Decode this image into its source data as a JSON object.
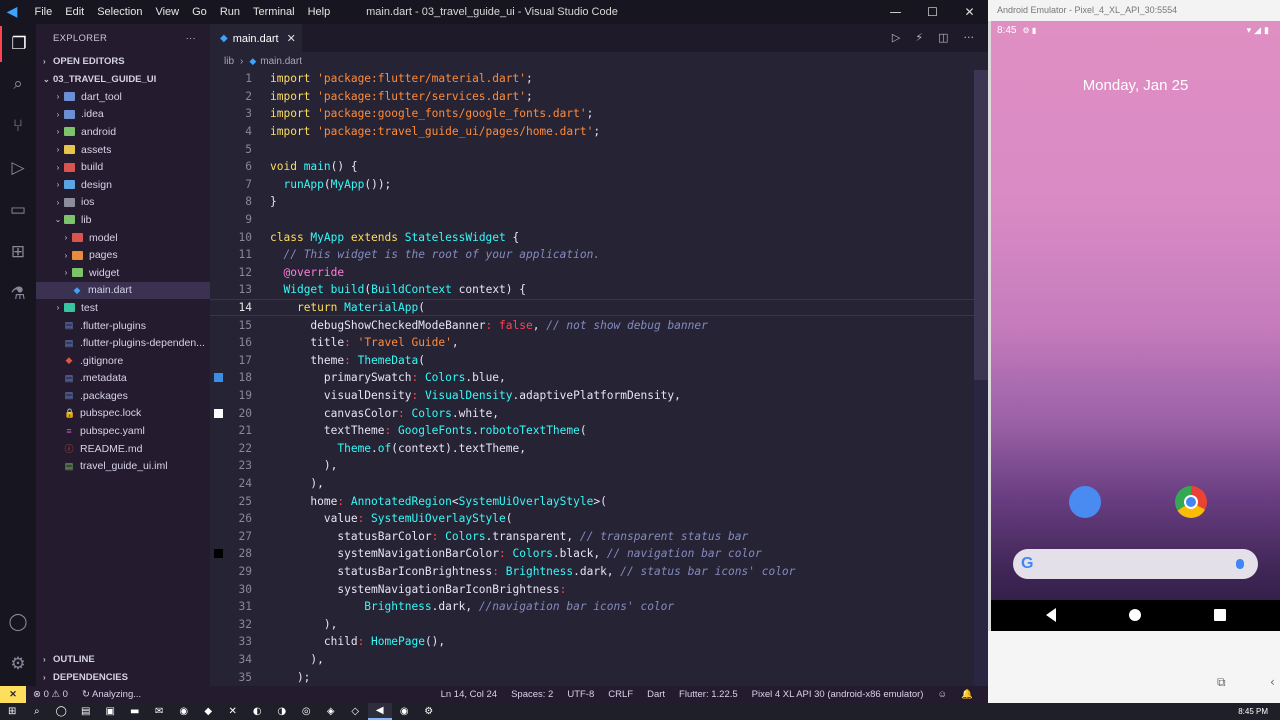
{
  "window": {
    "title": "main.dart - 03_travel_guide_ui - Visual Studio Code",
    "menu": [
      "File",
      "Edit",
      "Selection",
      "View",
      "Go",
      "Run",
      "Terminal",
      "Help"
    ]
  },
  "explorer": {
    "header": "EXPLORER",
    "more": "···",
    "open_editors": "OPEN EDITORS",
    "project": "03_TRAVEL_GUIDE_UI",
    "items": [
      {
        "label": "dart_tool",
        "color": "#6b8fd6",
        "kind": "folder",
        "depth": 1
      },
      {
        "label": ".idea",
        "color": "#6b8fd6",
        "kind": "folder",
        "depth": 1
      },
      {
        "label": "android",
        "color": "#7cc46b",
        "kind": "folder",
        "depth": 1
      },
      {
        "label": "assets",
        "color": "#e7c44a",
        "kind": "folder",
        "depth": 1
      },
      {
        "label": "build",
        "color": "#d9534f",
        "kind": "folder",
        "depth": 1
      },
      {
        "label": "design",
        "color": "#5aa5e6",
        "kind": "folder",
        "depth": 1
      },
      {
        "label": "ios",
        "color": "#8c8c9c",
        "kind": "folder",
        "depth": 1
      },
      {
        "label": "lib",
        "color": "#7cc46b",
        "kind": "folder-open",
        "depth": 1
      },
      {
        "label": "model",
        "color": "#d9534f",
        "kind": "folder",
        "depth": 2
      },
      {
        "label": "pages",
        "color": "#e98a3d",
        "kind": "folder",
        "depth": 2
      },
      {
        "label": "widget",
        "color": "#7cc46b",
        "kind": "folder",
        "depth": 2
      },
      {
        "label": "main.dart",
        "color": "#3ea3ff",
        "kind": "file-dart",
        "depth": 2
      },
      {
        "label": "test",
        "color": "#35c5a0",
        "kind": "folder",
        "depth": 1
      },
      {
        "label": ".flutter-plugins",
        "color": "#6b8fd6",
        "kind": "file",
        "depth": 1
      },
      {
        "label": ".flutter-plugins-dependen...",
        "color": "#6b8fd6",
        "kind": "file",
        "depth": 1
      },
      {
        "label": ".gitignore",
        "color": "#e0553d",
        "kind": "file-git",
        "depth": 1
      },
      {
        "label": ".metadata",
        "color": "#6b8fd6",
        "kind": "file",
        "depth": 1
      },
      {
        "label": ".packages",
        "color": "#6b8fd6",
        "kind": "file",
        "depth": 1
      },
      {
        "label": "pubspec.lock",
        "color": "#e7c44a",
        "kind": "file-lock",
        "depth": 1
      },
      {
        "label": "pubspec.yaml",
        "color": "#c75ab0",
        "kind": "file-yaml",
        "depth": 1
      },
      {
        "label": "README.md",
        "color": "#e0553d",
        "kind": "file-info",
        "depth": 1
      },
      {
        "label": "travel_guide_ui.iml",
        "color": "#7cc46b",
        "kind": "file",
        "depth": 1
      }
    ],
    "outline": "OUTLINE",
    "dependencies": "DEPENDENCIES"
  },
  "editor": {
    "tab": "main.dart",
    "breadcrumb": [
      "lib",
      "main.dart"
    ],
    "current_line": 14,
    "lines": [
      [
        [
          "k",
          "import "
        ],
        [
          "s",
          "'package:flutter/material.dart'"
        ],
        [
          "w",
          ";"
        ]
      ],
      [
        [
          "k",
          "import "
        ],
        [
          "s",
          "'package:flutter/services.dart'"
        ],
        [
          "w",
          ";"
        ]
      ],
      [
        [
          "k",
          "import "
        ],
        [
          "s",
          "'package:google_fonts/google_fonts.dart'"
        ],
        [
          "w",
          ";"
        ]
      ],
      [
        [
          "k",
          "import "
        ],
        [
          "s",
          "'package:travel_guide_ui/pages/home.dart'"
        ],
        [
          "w",
          ";"
        ]
      ],
      [],
      [
        [
          "k",
          "void "
        ],
        [
          "f",
          "main"
        ],
        [
          "w",
          "() {"
        ]
      ],
      [
        [
          "w",
          "  "
        ],
        [
          "f",
          "runApp"
        ],
        [
          "w",
          "("
        ],
        [
          "f",
          "MyApp"
        ],
        [
          "w",
          "());"
        ]
      ],
      [
        [
          "w",
          "}"
        ]
      ],
      [],
      [
        [
          "k",
          "class "
        ],
        [
          "f",
          "MyApp "
        ],
        [
          "k",
          "extends "
        ],
        [
          "f",
          "StatelessWidget "
        ],
        [
          "w",
          "{"
        ]
      ],
      [
        [
          "w",
          "  "
        ],
        [
          "c",
          "// This widget is the root of your application."
        ]
      ],
      [
        [
          "w",
          "  "
        ],
        [
          "p",
          "@override"
        ]
      ],
      [
        [
          "w",
          "  "
        ],
        [
          "f",
          "Widget "
        ],
        [
          "f",
          "build"
        ],
        [
          "w",
          "("
        ],
        [
          "f",
          "BuildContext "
        ],
        [
          "w",
          "context) {"
        ]
      ],
      [
        [
          "w",
          "    "
        ],
        [
          "k",
          "return "
        ],
        [
          "f",
          "MaterialApp"
        ],
        [
          "w",
          "("
        ]
      ],
      [
        [
          "w",
          "      debugShowCheckedModeBanner"
        ],
        [
          "t",
          ": "
        ],
        [
          "t",
          "false"
        ],
        [
          "w",
          ", "
        ],
        [
          "c",
          "// not show debug banner"
        ]
      ],
      [
        [
          "w",
          "      title"
        ],
        [
          "t",
          ": "
        ],
        [
          "s",
          "'Travel Guide'"
        ],
        [
          "w",
          ","
        ]
      ],
      [
        [
          "w",
          "      theme"
        ],
        [
          "t",
          ": "
        ],
        [
          "f",
          "ThemeData"
        ],
        [
          "w",
          "("
        ]
      ],
      [
        [
          "w",
          "        primarySwatch"
        ],
        [
          "t",
          ": "
        ],
        [
          "f",
          "Colors"
        ],
        [
          "w",
          ".blue,"
        ]
      ],
      [
        [
          "w",
          "        visualDensity"
        ],
        [
          "t",
          ": "
        ],
        [
          "f",
          "VisualDensity"
        ],
        [
          "w",
          ".adaptivePlatformDensity,"
        ]
      ],
      [
        [
          "w",
          "        canvasColor"
        ],
        [
          "t",
          ": "
        ],
        [
          "f",
          "Colors"
        ],
        [
          "w",
          ".white,"
        ]
      ],
      [
        [
          "w",
          "        textTheme"
        ],
        [
          "t",
          ": "
        ],
        [
          "f",
          "GoogleFonts"
        ],
        [
          "w",
          "."
        ],
        [
          "f",
          "robotoTextTheme"
        ],
        [
          "w",
          "("
        ]
      ],
      [
        [
          "w",
          "          "
        ],
        [
          "f",
          "Theme"
        ],
        [
          "w",
          "."
        ],
        [
          "f",
          "of"
        ],
        [
          "w",
          "(context).textTheme,"
        ]
      ],
      [
        [
          "w",
          "        ),"
        ]
      ],
      [
        [
          "w",
          "      ),"
        ]
      ],
      [
        [
          "w",
          "      home"
        ],
        [
          "t",
          ": "
        ],
        [
          "f",
          "AnnotatedRegion"
        ],
        [
          "w",
          "<"
        ],
        [
          "f",
          "SystemUiOverlayStyle"
        ],
        [
          "w",
          ">("
        ]
      ],
      [
        [
          "w",
          "        value"
        ],
        [
          "t",
          ": "
        ],
        [
          "f",
          "SystemUiOverlayStyle"
        ],
        [
          "w",
          "("
        ]
      ],
      [
        [
          "w",
          "          statusBarColor"
        ],
        [
          "t",
          ": "
        ],
        [
          "f",
          "Colors"
        ],
        [
          "w",
          ".transparent, "
        ],
        [
          "c",
          "// transparent status bar"
        ]
      ],
      [
        [
          "w",
          "          systemNavigationBarColor"
        ],
        [
          "t",
          ": "
        ],
        [
          "f",
          "Colors"
        ],
        [
          "w",
          ".black, "
        ],
        [
          "c",
          "// navigation bar color"
        ]
      ],
      [
        [
          "w",
          "          statusBarIconBrightness"
        ],
        [
          "t",
          ": "
        ],
        [
          "f",
          "Brightness"
        ],
        [
          "w",
          ".dark, "
        ],
        [
          "c",
          "// status bar icons' color"
        ]
      ],
      [
        [
          "w",
          "          systemNavigationBarIconBrightness"
        ],
        [
          "t",
          ":"
        ]
      ],
      [
        [
          "w",
          "              "
        ],
        [
          "f",
          "Brightness"
        ],
        [
          "w",
          ".dark, "
        ],
        [
          "c",
          "//navigation bar icons' color"
        ]
      ],
      [
        [
          "w",
          "        ),"
        ]
      ],
      [
        [
          "w",
          "        child"
        ],
        [
          "t",
          ": "
        ],
        [
          "f",
          "HomePage"
        ],
        [
          "w",
          "(),"
        ]
      ],
      [
        [
          "w",
          "      ),"
        ]
      ],
      [
        [
          "w",
          "    );"
        ]
      ]
    ],
    "gutter_marks": [
      {
        "line": 18,
        "color": "#3a8ee6"
      },
      {
        "line": 20,
        "color": "#ffffff"
      },
      {
        "line": 28,
        "color": "#000000"
      }
    ]
  },
  "statusbar": {
    "remote": "✕",
    "problems": "⊗ 0  ⚠ 0",
    "analyzing": "↻ Analyzing...",
    "position": "Ln 14, Col 24",
    "spaces": "Spaces: 2",
    "encoding": "UTF-8",
    "eol": "CRLF",
    "language": "Dart",
    "flutter": "Flutter: 1.22.5",
    "device": "Pixel 4 XL API 30 (android-x86 emulator)"
  },
  "emulator": {
    "title": "Android Emulator - Pixel_4_XL_API_30:5554",
    "time": "8:45",
    "date": "Monday, Jan 25"
  },
  "taskbar": {
    "time": "8:45 PM"
  },
  "colors": {
    "editor_bg": "#262335",
    "sidebar_bg": "#241b2f",
    "accent": "#fe4450"
  }
}
